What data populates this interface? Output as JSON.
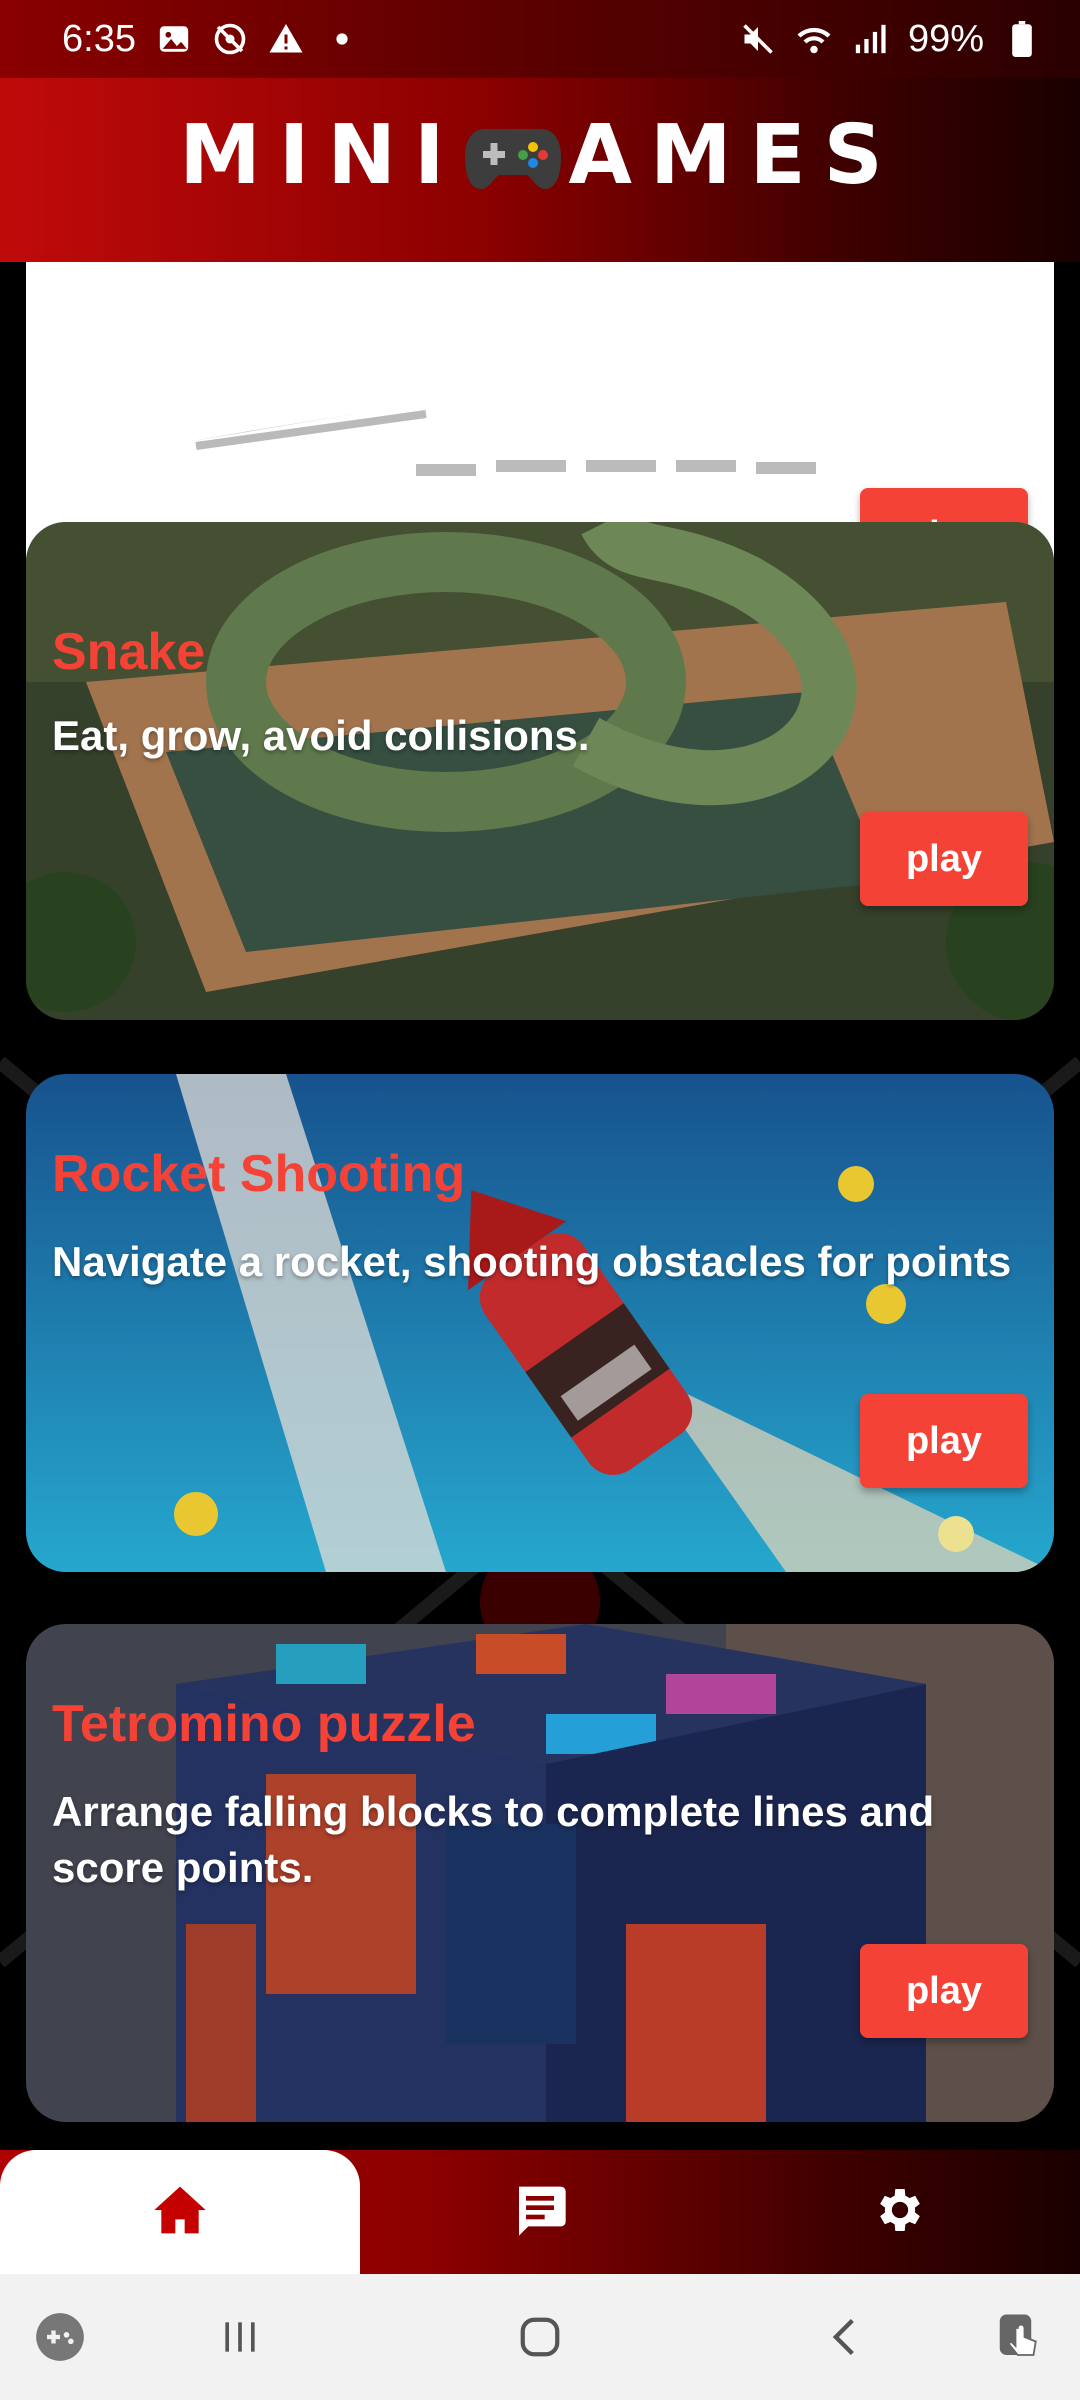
{
  "status_bar": {
    "time": "6:35",
    "battery": "99%"
  },
  "header": {
    "title_before": "MINI",
    "title_after": "AMES"
  },
  "cards": [
    {
      "title": "",
      "description": "",
      "button": "play"
    },
    {
      "title": "Snake",
      "description": "Eat, grow, avoid collisions.",
      "button": "play"
    },
    {
      "title": "Rocket Shooting",
      "description": "Navigate a rocket, shooting obstacles for points",
      "button": "play"
    },
    {
      "title": "Tetromino puzzle",
      "description": "Arrange falling blocks to complete lines and score points.",
      "button": "play"
    }
  ],
  "bottom_nav": {
    "tabs": [
      {
        "icon": "home-icon",
        "selected": true
      },
      {
        "icon": "chat-icon",
        "selected": false
      },
      {
        "icon": "settings-icon",
        "selected": false
      }
    ]
  },
  "colors": {
    "accent": "#f44336",
    "header_red": "#c00a0a",
    "dark_red": "#8b0000"
  }
}
